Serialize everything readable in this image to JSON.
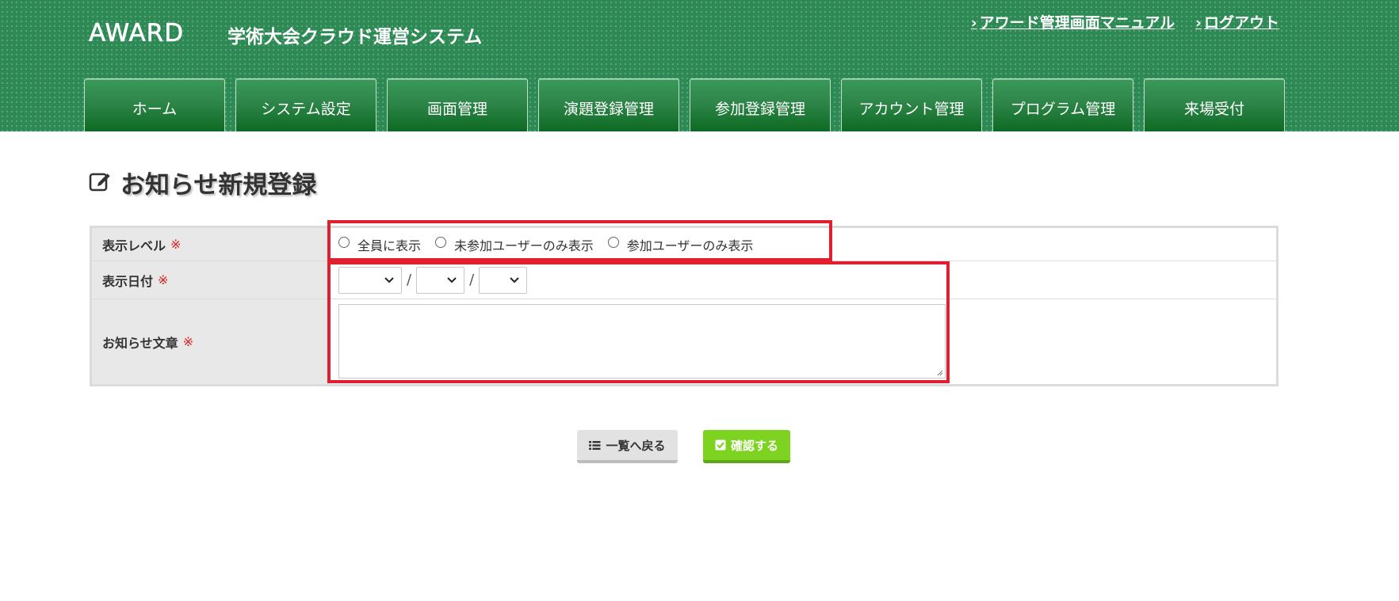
{
  "header": {
    "logo_text": "AWARD",
    "system_title": "学術大会クラウド運営システム",
    "links": [
      {
        "label": "アワード管理画面マニュアル"
      },
      {
        "label": "ログアウト"
      }
    ],
    "nav": [
      {
        "label": "ホーム"
      },
      {
        "label": "システム設定"
      },
      {
        "label": "画面管理"
      },
      {
        "label": "演題登録管理"
      },
      {
        "label": "参加登録管理"
      },
      {
        "label": "アカウント管理"
      },
      {
        "label": "プログラム管理"
      },
      {
        "label": "来場受付"
      }
    ],
    "colors": {
      "header_bg": "#2e8a55",
      "tab_bottom": "#0d6a22"
    }
  },
  "page": {
    "title": "お知らせ新規登録",
    "title_icon": "edit-icon"
  },
  "form": {
    "required_mark": "※",
    "level": {
      "label": "表示レベル",
      "options": [
        {
          "label": "全員に表示",
          "selected": false
        },
        {
          "label": "未参加ユーザーのみ表示",
          "selected": false
        },
        {
          "label": "参加ユーザーのみ表示",
          "selected": false
        }
      ]
    },
    "date": {
      "label": "表示日付",
      "separator": "/",
      "year": "",
      "month": "",
      "day": ""
    },
    "text": {
      "label": "お知らせ文章",
      "value": ""
    }
  },
  "buttons": {
    "back": {
      "label": "一覧へ戻る",
      "icon": "list-icon"
    },
    "confirm": {
      "label": "確認する",
      "icon": "check-square-icon",
      "color": "#7ed321"
    }
  },
  "highlight_color": "#e02030"
}
